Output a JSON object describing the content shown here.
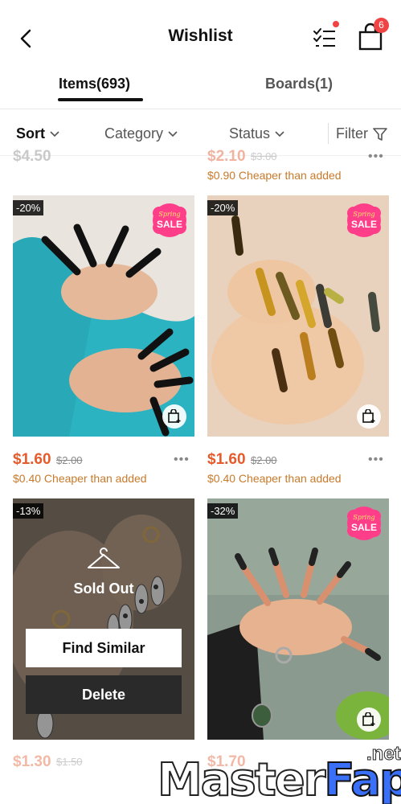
{
  "header": {
    "title": "Wishlist",
    "cart_count": "6"
  },
  "tabs": [
    {
      "label": "Items(693)",
      "active": true
    },
    {
      "label": "Boards(1)",
      "active": false
    }
  ],
  "filterbar": {
    "sort": "Sort",
    "category": "Category",
    "status": "Status",
    "filter": "Filter"
  },
  "partial_top": {
    "left_price": "$4.50",
    "right_price": "$2.10",
    "right_old_price": "$3.00",
    "right_cheaper": "$0.90 Cheaper than added"
  },
  "products": [
    {
      "discount": "-20%",
      "price": "$1.60",
      "old_price": "$2.00",
      "cheaper": "$0.40 Cheaper than added",
      "sale_badge": "SALE",
      "sale_script": "Spring"
    },
    {
      "discount": "-20%",
      "price": "$1.60",
      "old_price": "$2.00",
      "cheaper": "$0.40 Cheaper than added",
      "sale_badge": "SALE",
      "sale_script": "Spring"
    },
    {
      "discount": "-13%",
      "sold_out": "Sold Out",
      "find_similar": "Find Similar",
      "delete": "Delete"
    },
    {
      "discount": "-32%",
      "sale_badge": "SALE",
      "sale_script": "Spring"
    }
  ],
  "partial_bottom": {
    "left_price": "$1.30",
    "left_old_price": "$1.50",
    "right_price": "$1.70"
  },
  "watermark": {
    "master": "Master",
    "fap": "Fap",
    "net": ".net"
  },
  "colors": {
    "accent": "#e55b2b",
    "badge": "#f04444",
    "cheaper": "#c77a2b",
    "sale_pink": "#ff3e8a"
  }
}
